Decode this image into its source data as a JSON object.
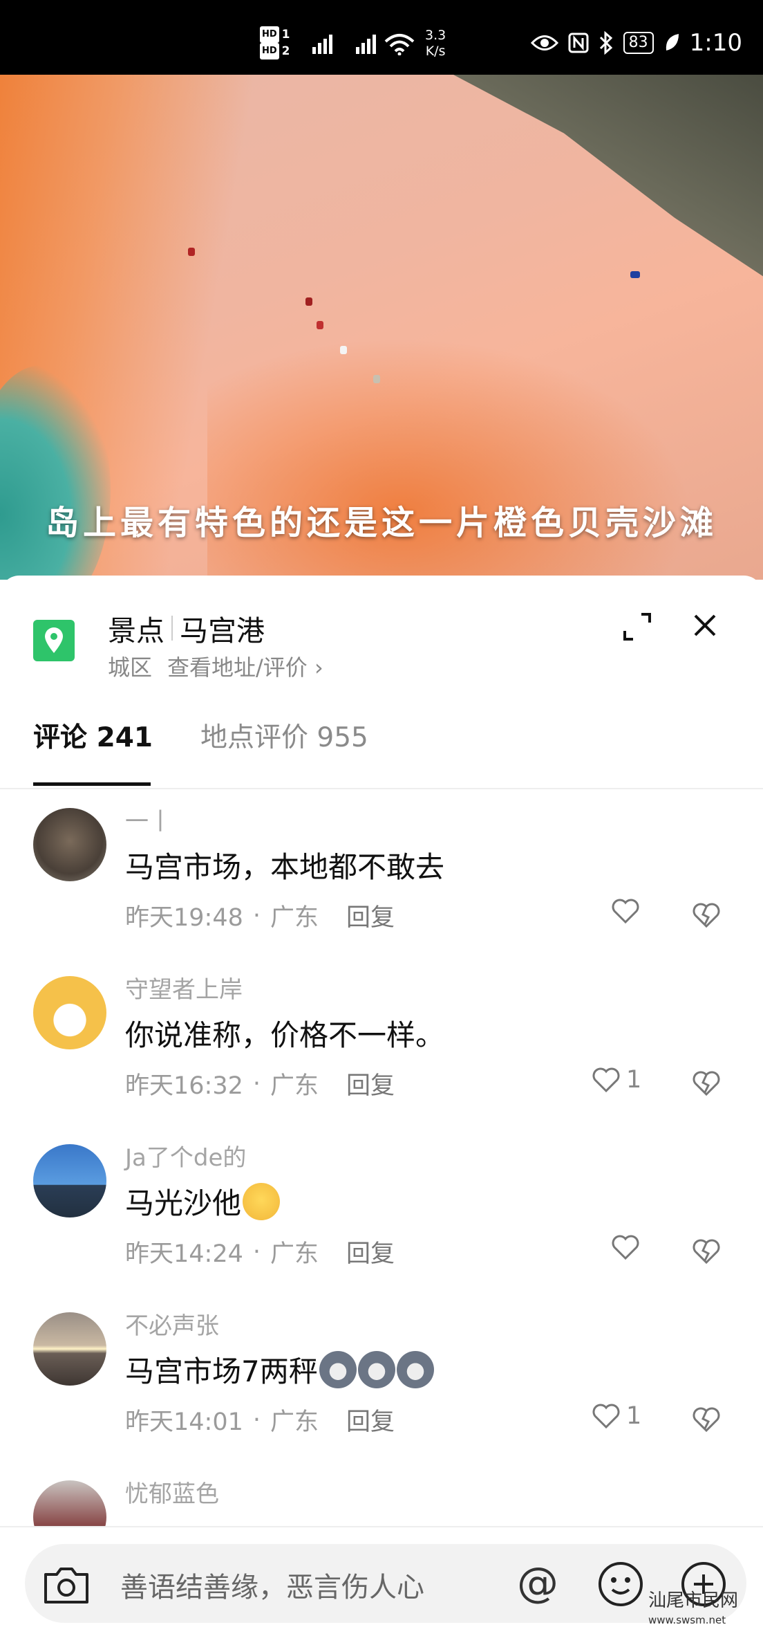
{
  "status_bar": {
    "hd1": "HD",
    "hd1_num": "1",
    "hd2": "HD",
    "hd2_num": "2",
    "net_speed_value": "3.3",
    "net_speed_unit": "K/s",
    "battery": "83",
    "time": "1:10"
  },
  "video": {
    "caption": "岛上最有特色的还是这一片橙色贝壳沙滩"
  },
  "location": {
    "category": "景点",
    "name": "马宫港",
    "district": "城区",
    "address_link": "查看地址/评价 ›",
    "icon": "location-pin-icon",
    "accent": "#2ec46a"
  },
  "tabs": {
    "comments": "评论 241",
    "reviews": "地点评价 955"
  },
  "comments": [
    {
      "user": "一丨",
      "text": "马宫市场，本地都不敢去",
      "time": "昨天19:48",
      "region": "广东",
      "reply": "回复",
      "likes": ""
    },
    {
      "user": "守望者上岸",
      "text": "你说准称，价格不一样。",
      "time": "昨天16:32",
      "region": "广东",
      "reply": "回复",
      "likes": "1"
    },
    {
      "user": "Ja了个de的",
      "text": "马光沙他",
      "time": "昨天14:24",
      "region": "广东",
      "reply": "回复",
      "likes": ""
    },
    {
      "user": "不必声张",
      "text": "马宫市场7两秤",
      "time": "昨天14:01",
      "region": "广东",
      "reply": "回复",
      "likes": "1"
    },
    {
      "user": "忧郁蓝色"
    }
  ],
  "input": {
    "placeholder": "善语结善缘，恶言伤人心",
    "at_symbol": "@"
  },
  "watermark": {
    "name": "汕尾市民网",
    "url": "www.swsm.net"
  }
}
